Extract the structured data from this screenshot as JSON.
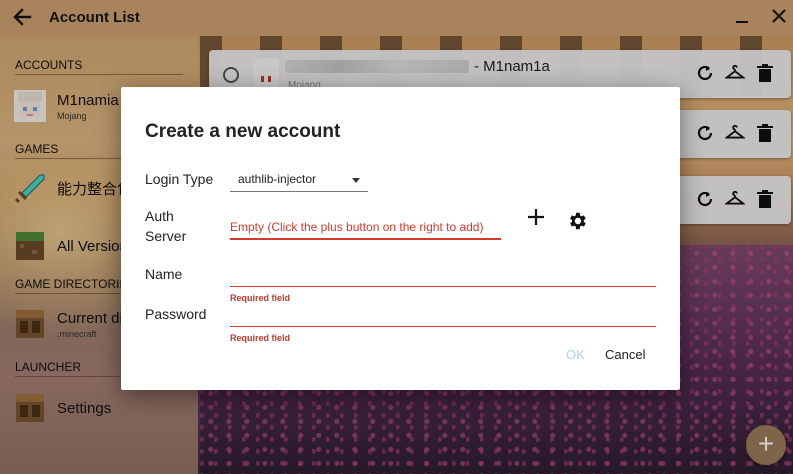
{
  "window": {
    "title": "Account List",
    "back_icon": "arrow-left-icon",
    "minimize_icon": "minimize-icon",
    "close_icon": "close-icon"
  },
  "sidebar": {
    "sections": {
      "accounts": "ACCOUNTS",
      "games": "GAMES",
      "game_directories": "GAME DIRECTORIES",
      "launcher": "LAUNCHER"
    },
    "account": {
      "name": "M1namia",
      "type": "Mojang"
    },
    "games": [
      {
        "label": "能力整合包"
      },
      {
        "label": "All Versions"
      }
    ],
    "directory": {
      "label": "Current dir",
      "sub": ".minecraft"
    },
    "launcher": {
      "label": "Settings"
    }
  },
  "accounts": [
    {
      "name": "- M1nam1a",
      "type": "Mojang"
    },
    {
      "name": "",
      "type": ""
    },
    {
      "name": "",
      "type": ""
    }
  ],
  "dialog": {
    "title": "Create a new account",
    "login_type_label": "Login Type",
    "login_type_value": "authlib-injector",
    "auth_server_label_1": "Auth",
    "auth_server_label_2": "Server",
    "auth_server_placeholder": "Empty (Click the plus button on the right to add)",
    "name_label": "Name",
    "password_label": "Password",
    "required_error": "Required field",
    "ok_label": "OK",
    "cancel_label": "Cancel"
  },
  "fab": {
    "label": "+"
  },
  "colors": {
    "error": "#d23b2c",
    "ok_disabled": "#a6d6ee",
    "titlebar": "#a8835c",
    "fab": "#9b7b5a"
  }
}
